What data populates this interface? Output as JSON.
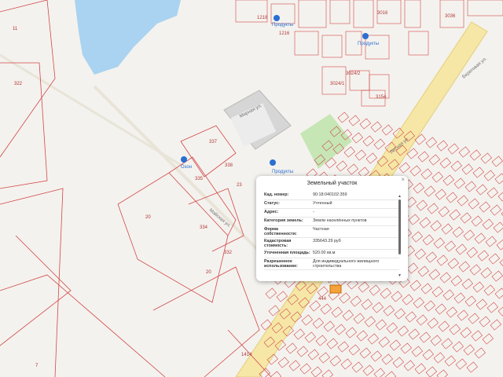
{
  "map": {
    "parcel_numbers": [
      "11",
      "322",
      "20",
      "20",
      "7",
      "1414",
      "23",
      "337",
      "335",
      "334",
      "332",
      "338",
      "1218",
      "1216",
      "3036",
      "3024/1",
      "3024/2",
      "3016",
      "3154",
      "444"
    ],
    "street_labels": [
      "Мирная ул.",
      "Майская ул.",
      "Лесная ул.",
      "Береговая ул."
    ],
    "poi_labels": [
      "Продукты",
      "Продукты",
      "Продукты",
      "Озон"
    ],
    "colors": {
      "background": "#f4f2ee",
      "water": "#a9d3f0",
      "park": "#c6e6b5",
      "road": "#f6e7a6",
      "parcel_line": "#d04848",
      "building": "#d6d6d6"
    }
  },
  "popup": {
    "title": "Земельный участок",
    "close_label": "×",
    "rows": [
      {
        "key": "Кад. номер:",
        "value": "90:18:040102:359"
      },
      {
        "key": "Статус:",
        "value": "Учтенный"
      },
      {
        "key": "Адрес:",
        "value": "-"
      },
      {
        "key": "Категория земель:",
        "value": "Земли населённых пунктов"
      },
      {
        "key": "Форма собственности:",
        "value": "Частная"
      },
      {
        "key": "Кадастровая стоимость:",
        "value": "335643.29 руб"
      },
      {
        "key": "Уточненная площадь:",
        "value": "520.00 кв.м"
      },
      {
        "key": "Разрешенное использование:",
        "value": "Для индивидуального жилищного строительства"
      }
    ],
    "scroll_up": "▲",
    "scroll_down": "▼"
  }
}
